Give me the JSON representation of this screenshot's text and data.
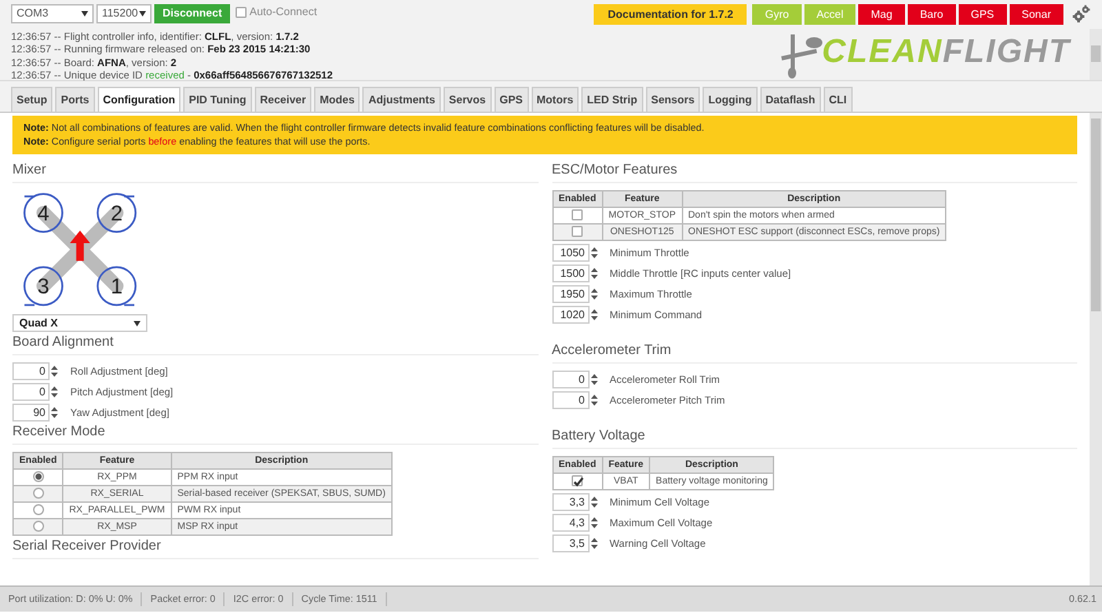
{
  "top_bar": {
    "port": "COM3",
    "baud": "115200",
    "connect_button": "Disconnect",
    "auto_connect": {
      "label": "Auto-Connect",
      "checked": false
    },
    "docs_button": "Documentation for 1.7.2",
    "sensors": [
      {
        "label": "Gyro",
        "color": "#a4cd39"
      },
      {
        "label": "Accel",
        "color": "#a4cd39"
      },
      {
        "label": "Mag",
        "color": "#e2001a"
      },
      {
        "label": "Baro",
        "color": "#e2001a"
      },
      {
        "label": "GPS",
        "color": "#e2001a"
      },
      {
        "label": "Sonar",
        "color": "#e2001a"
      }
    ]
  },
  "log": [
    [
      {
        "text": "12:36:57 -- Flight controller info, identifier: ",
        "kind": "plain"
      },
      {
        "text": "CLFL",
        "kind": "bold"
      },
      {
        "text": ", version: ",
        "kind": "plain"
      },
      {
        "text": "1.7.2",
        "kind": "bold"
      }
    ],
    [
      {
        "text": "12:36:57 -- Running firmware released on: ",
        "kind": "plain"
      },
      {
        "text": "Feb 23 2015 14:21:30",
        "kind": "bold"
      }
    ],
    [
      {
        "text": "12:36:57 -- Board: ",
        "kind": "plain"
      },
      {
        "text": "AFNA",
        "kind": "bold"
      },
      {
        "text": ", version: ",
        "kind": "plain"
      },
      {
        "text": "2",
        "kind": "bold"
      }
    ],
    [
      {
        "text": "12:36:57 -- Unique device ID ",
        "kind": "plain"
      },
      {
        "text": "received",
        "kind": "ok"
      },
      {
        "text": " - ",
        "kind": "plain"
      },
      {
        "text": "0x66aff564856676767132512",
        "kind": "bold"
      }
    ]
  ],
  "logo": [
    {
      "text": "CLEAN",
      "kind": "accent"
    },
    {
      "text": "FLIGHT",
      "kind": "plain"
    }
  ],
  "tabs": [
    {
      "label": "Setup",
      "selected": false
    },
    {
      "label": "Ports",
      "selected": false
    },
    {
      "label": "Configuration",
      "selected": true
    },
    {
      "label": "PID Tuning",
      "selected": false
    },
    {
      "label": "Receiver",
      "selected": false
    },
    {
      "label": "Modes",
      "selected": false
    },
    {
      "label": "Adjustments",
      "selected": false
    },
    {
      "label": "Servos",
      "selected": false
    },
    {
      "label": "GPS",
      "selected": false
    },
    {
      "label": "Motors",
      "selected": false
    },
    {
      "label": "LED Strip",
      "selected": false
    },
    {
      "label": "Sensors",
      "selected": false
    },
    {
      "label": "Logging",
      "selected": false
    },
    {
      "label": "Dataflash",
      "selected": false
    },
    {
      "label": "CLI",
      "selected": false
    }
  ],
  "notes": [
    [
      {
        "text": "Note:",
        "kind": "bold"
      },
      {
        "text": " Not all combinations of features are valid. When the flight controller firmware detects invalid feature combinations conflicting features will be disabled.",
        "kind": "plain"
      }
    ],
    [
      {
        "text": "Note:",
        "kind": "bold"
      },
      {
        "text": " Configure serial ports ",
        "kind": "plain"
      },
      {
        "text": "before",
        "kind": "warn"
      },
      {
        "text": " enabling the features that will use the ports.",
        "kind": "plain"
      }
    ]
  ],
  "mixer": {
    "title": "Mixer",
    "motor_labels": [
      "4",
      "2",
      "3",
      "1"
    ],
    "type": "Quad X"
  },
  "board_alignment": {
    "title": "Board Alignment",
    "fields": [
      {
        "value": "0",
        "label": "Roll Adjustment [deg]"
      },
      {
        "value": "0",
        "label": "Pitch Adjustment [deg]"
      },
      {
        "value": "90",
        "label": "Yaw Adjustment [deg]"
      }
    ]
  },
  "receiver_mode": {
    "title": "Receiver Mode",
    "columns": [
      "Enabled",
      "Feature",
      "Description"
    ],
    "rows": [
      {
        "selected": true,
        "feature": "RX_PPM",
        "description": "PPM RX input"
      },
      {
        "selected": false,
        "feature": "RX_SERIAL",
        "description": "Serial-based receiver (SPEKSAT, SBUS, SUMD)"
      },
      {
        "selected": false,
        "feature": "RX_PARALLEL_PWM",
        "description": "PWM RX input"
      },
      {
        "selected": false,
        "feature": "RX_MSP",
        "description": "MSP RX input"
      }
    ]
  },
  "serial_receiver_provider": {
    "title": "Serial Receiver Provider"
  },
  "esc_motor_features": {
    "title": "ESC/Motor Features",
    "columns": [
      "Enabled",
      "Feature",
      "Description"
    ],
    "rows": [
      {
        "checked": false,
        "feature": "MOTOR_STOP",
        "description": "Don't spin the motors when armed"
      },
      {
        "checked": false,
        "feature": "ONESHOT125",
        "description": "ONESHOT ESC support (disconnect ESCs, remove props)"
      }
    ],
    "fields": [
      {
        "value": "1050",
        "label": "Minimum Throttle"
      },
      {
        "value": "1500",
        "label": "Middle Throttle [RC inputs center value]"
      },
      {
        "value": "1950",
        "label": "Maximum Throttle"
      },
      {
        "value": "1020",
        "label": "Minimum Command"
      }
    ]
  },
  "accelerometer_trim": {
    "title": "Accelerometer Trim",
    "fields": [
      {
        "value": "0",
        "label": "Accelerometer Roll Trim"
      },
      {
        "value": "0",
        "label": "Accelerometer Pitch Trim"
      }
    ]
  },
  "battery_voltage": {
    "title": "Battery Voltage",
    "columns": [
      "Enabled",
      "Feature",
      "Description"
    ],
    "rows": [
      {
        "checked": true,
        "feature": "VBAT",
        "description": "Battery voltage monitoring"
      }
    ],
    "fields": [
      {
        "value": "3,3",
        "label": "Minimum Cell Voltage"
      },
      {
        "value": "4,3",
        "label": "Maximum Cell Voltage"
      },
      {
        "value": "3,5",
        "label": "Warning Cell Voltage"
      }
    ]
  },
  "status_bar": {
    "items": [
      "Port utilization: D: 0% U: 0%",
      "Packet error: 0",
      "I2C error: 0",
      "Cycle Time: 1511"
    ],
    "version": "0.62.1"
  }
}
